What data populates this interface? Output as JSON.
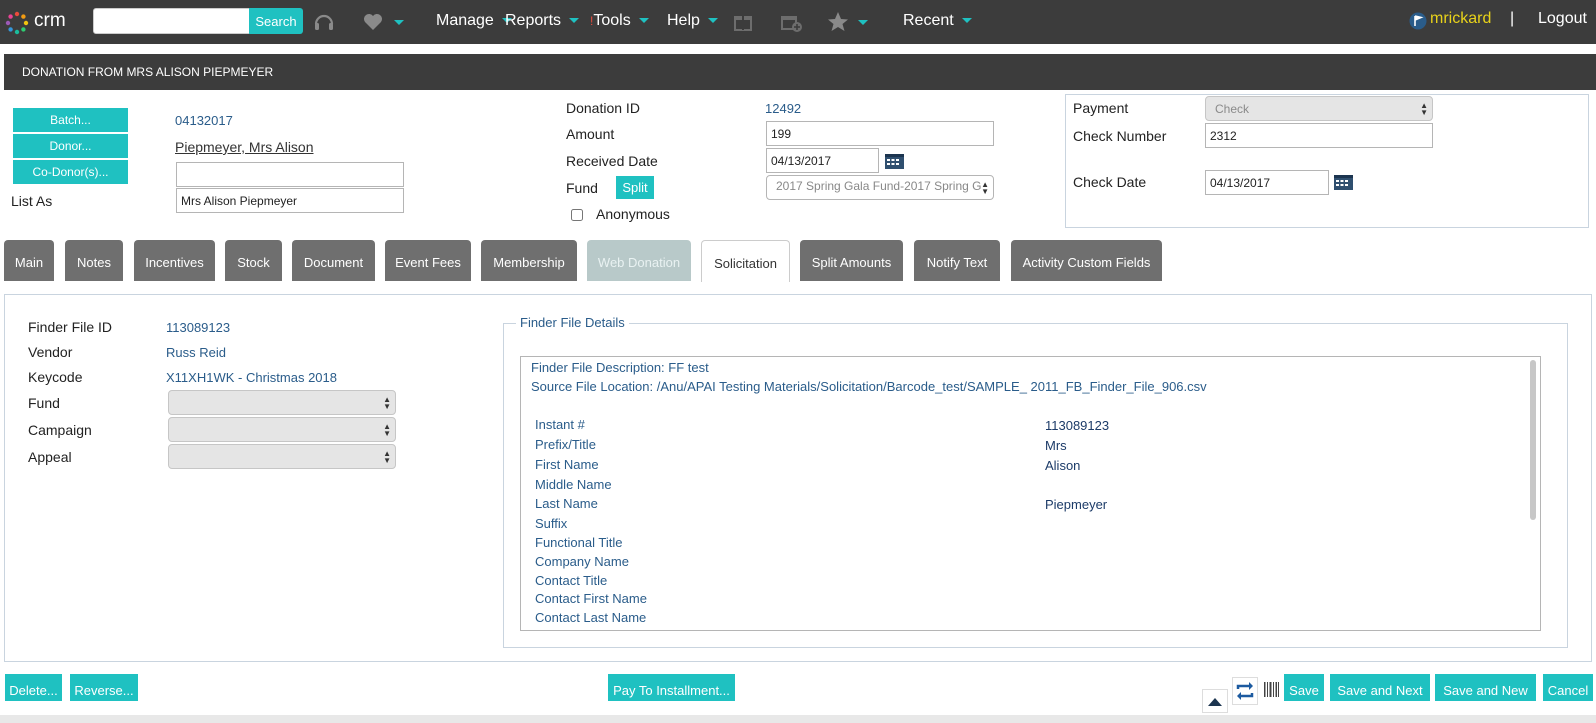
{
  "topbar": {
    "logo_text": "crm",
    "search_placeholder": "",
    "search_label": "Search",
    "nav": [
      "Manage",
      "Reports",
      "Tools",
      "Help",
      "Recent"
    ],
    "username": "mrickard",
    "separator": "|",
    "logout": "Logout"
  },
  "title": "DONATION FROM MRS ALISON PIEPMEYER",
  "left": {
    "batch_btn": "Batch...",
    "donor_btn": "Donor...",
    "codonor_btn": "Co-Donor(s)...",
    "batch_value": "04132017",
    "donor_value": "Piepmeyer, Mrs Alison",
    "codonor_value": "",
    "list_as_label": "List As",
    "list_as_value": "Mrs Alison Piepmeyer"
  },
  "middle": {
    "donation_id_label": "Donation ID",
    "donation_id_value": "12492",
    "amount_label": "Amount",
    "amount_value": "199",
    "received_label": "Received Date",
    "received_value": "04/13/2017",
    "fund_label": "Fund",
    "split_btn": "Split",
    "fund_value": "2017 Spring Gala Fund-2017 Spring G",
    "anonymous_label": "Anonymous"
  },
  "payment": {
    "payment_label": "Payment",
    "payment_value": "Check",
    "check_number_label": "Check Number",
    "check_number_value": "2312",
    "check_date_label": "Check Date",
    "check_date_value": "04/13/2017"
  },
  "tabs": [
    "Main",
    "Notes",
    "Incentives",
    "Stock",
    "Document",
    "Event Fees",
    "Membership",
    "Web Donation",
    "Solicitation",
    "Split Amounts",
    "Notify Text",
    "Activity Custom Fields"
  ],
  "solicitation": {
    "finder_id_label": "Finder File ID",
    "finder_id_value": "113089123",
    "vendor_label": "Vendor",
    "vendor_value": "Russ Reid",
    "keycode_label": "Keycode",
    "keycode_value": "X11XH1WK - Christmas 2018",
    "fund_label": "Fund",
    "campaign_label": "Campaign",
    "appeal_label": "Appeal",
    "details_legend": "Finder File Details",
    "description": "Finder File Description: FF test",
    "source": "Source File Location: /Anu/APAI Testing Materials/Solicitation/Barcode_test/SAMPLE_ 2011_FB_Finder_File_906.csv",
    "rows": [
      {
        "label": "Instant #",
        "value": "113089123"
      },
      {
        "label": "Prefix/Title",
        "value": "Mrs"
      },
      {
        "label": "First Name",
        "value": "Alison"
      },
      {
        "label": "Middle Name",
        "value": ""
      },
      {
        "label": "Last Name",
        "value": "Piepmeyer"
      },
      {
        "label": "Suffix",
        "value": ""
      },
      {
        "label": "Functional Title",
        "value": ""
      },
      {
        "label": "Company Name",
        "value": ""
      },
      {
        "label": "Contact Title",
        "value": ""
      },
      {
        "label": "Contact First Name",
        "value": ""
      },
      {
        "label": "Contact Last Name",
        "value": ""
      }
    ]
  },
  "footer": {
    "delete": "Delete...",
    "reverse": "Reverse...",
    "pay_installment": "Pay To Installment...",
    "save": "Save",
    "save_next": "Save and Next",
    "save_new": "Save and New",
    "cancel": "Cancel"
  },
  "colors": {
    "accent": "#1fc1c1",
    "topbar": "#3c3c3c",
    "link": "#2a5c8a",
    "username": "#e8d21a"
  }
}
